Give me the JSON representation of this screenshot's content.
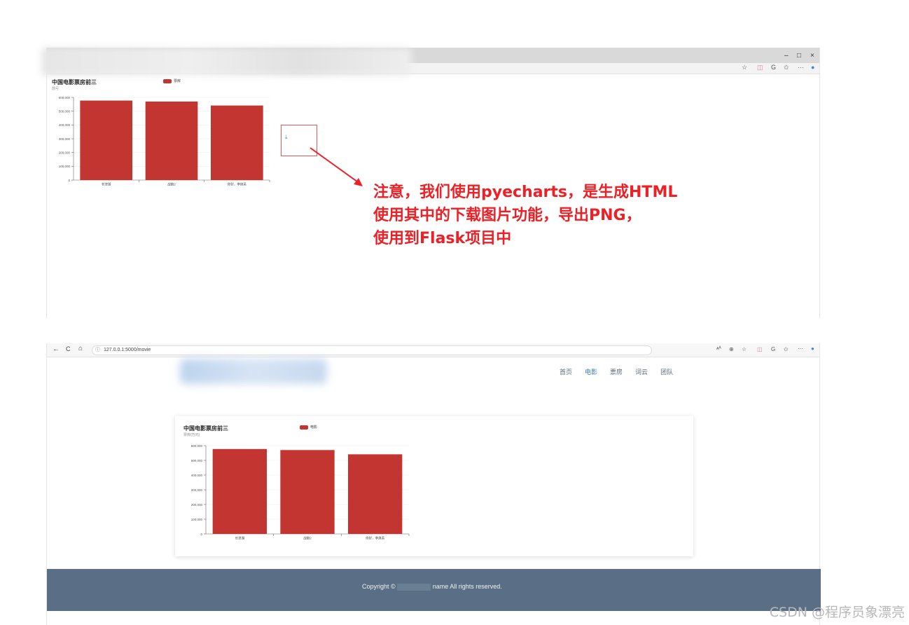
{
  "top_window": {
    "window_controls": [
      "–",
      "□",
      "×"
    ],
    "toolbar_icons": [
      "☆",
      "◫",
      "G",
      "✩",
      "···",
      "●"
    ]
  },
  "annotation": {
    "line1": "注意，我们使用pyecharts，是生成HTML",
    "line2": "使用其中的下载图片功能，导出PNG，",
    "line3": "使用到Flask项目中"
  },
  "bottom_window": {
    "nav_back": "←",
    "nav_reload": "C",
    "nav_home": "⌂",
    "address": "127.0.0.1:5000/movie",
    "toolbar_icons": [
      "ᴀᴬ",
      "⊕",
      "☆",
      "◫",
      "G",
      "✩",
      "···",
      "●"
    ],
    "nav": [
      "首页",
      "电影",
      "票房",
      "词云",
      "团队"
    ],
    "nav_active_index": 1,
    "footer_before": "Copyright ©",
    "footer_after": "name All rights reserved."
  },
  "watermark": "CSDN @程序员象漂亮",
  "accent_color": "#ee1f25",
  "footer_color": "#5a6f86",
  "chart_data": [
    {
      "type": "bar",
      "title": "中国电影票房前三",
      "subtitle": "前亏",
      "legend": [
        "票房"
      ],
      "categories": [
        "长津湖",
        "战狼2",
        "你好，李焕英"
      ],
      "values": [
        577000,
        570000,
        541000
      ],
      "yticks": [
        "0",
        "100,000",
        "200,000",
        "300,000",
        "400,000",
        "500,000",
        "600,000"
      ],
      "ylim": [
        0,
        600000
      ],
      "color": "#c23531"
    },
    {
      "type": "bar",
      "title": "中国电影票房前三",
      "subtitle": "票房(万元)",
      "legend": [
        "电影"
      ],
      "categories": [
        "长津湖",
        "战狼2",
        "你好，李焕英"
      ],
      "values": [
        577000,
        570000,
        541000
      ],
      "yticks": [
        "0",
        "100,000",
        "200,000",
        "300,000",
        "400,000",
        "500,000",
        "600,000"
      ],
      "ylim": [
        0,
        600000
      ],
      "color": "#c23531"
    }
  ]
}
